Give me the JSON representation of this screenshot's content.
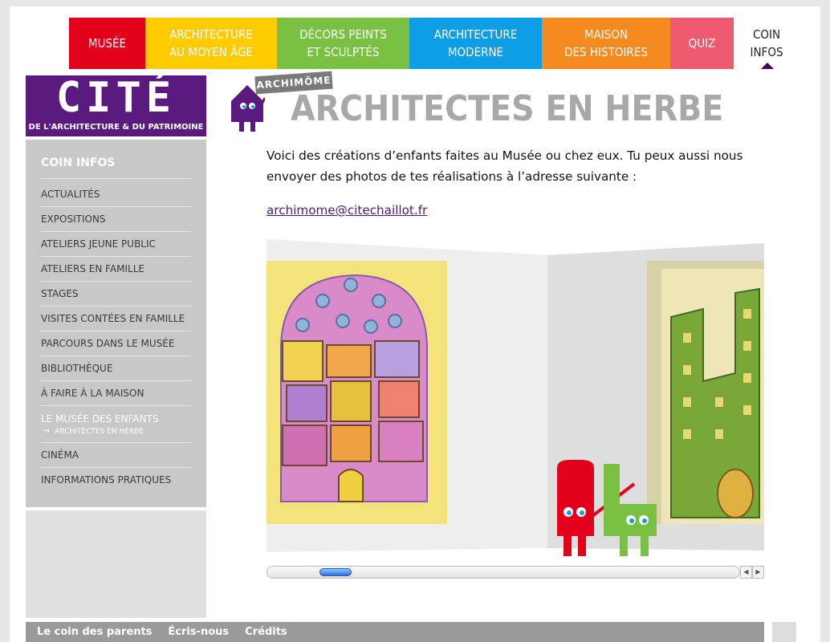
{
  "nav": {
    "tabs": [
      {
        "line1": "Musée",
        "line2": ""
      },
      {
        "line1": "Architecture",
        "line2": "au Moyen Âge"
      },
      {
        "line1": "Décors peints",
        "line2": "et sculptés"
      },
      {
        "line1": "Architecture",
        "line2": "moderne"
      },
      {
        "line1": "Maison",
        "line2": "des histoires"
      },
      {
        "line1": "Quiz",
        "line2": ""
      },
      {
        "line1": "Coin",
        "line2": "infos"
      }
    ]
  },
  "logo": {
    "word": "CITÉ",
    "subtitle": "DE L'ARCHITECTURE & DU PATRIMOINE"
  },
  "sidebar": {
    "title": "COIN INFOS",
    "items": [
      "ACTUALITÉS",
      "EXPOSITIONS",
      "ATELIERS JEUNE PUBLIC",
      "ATELIERS EN FAMILLE",
      "STAGES",
      "VISITES CONTÉES EN FAMILLE",
      "PARCOURS DANS LE MUSÉE",
      "BIBLIOTHÈQUE",
      "À FAIRE À LA MAISON"
    ],
    "current": "LE MUSÉE DES ENFANTS",
    "current_sub": "ARCHITECTES EN HERBE",
    "items_after": [
      "CINÉMA",
      "INFORMATIONS PRATIQUES"
    ]
  },
  "header": {
    "tag": "ARCHIMÔME",
    "title": "ARCHITECTES EN HERBE"
  },
  "content": {
    "intro": "Voici des créations d’enfants faites au Musée ou chez eux. Tu peux aussi nous envoyer des photos de tes réalisations à l’adresse suivante :",
    "email": "archimome@citechaillot.fr"
  },
  "colors": {
    "musee": "#e3001b",
    "moyen_age": "#fdcb00",
    "decors": "#7ac143",
    "moderne": "#0d9ee5",
    "histoires": "#f58a1f",
    "quiz": "#ef5a71",
    "brand_purple": "#5a1a7e"
  },
  "footer": {
    "links": [
      "Le coin des parents",
      "Écris-nous",
      "Crédits"
    ]
  }
}
